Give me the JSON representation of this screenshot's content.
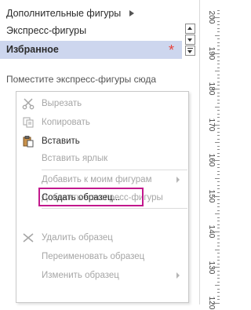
{
  "shapes_panel": {
    "more_shapes": "Дополнительные фигуры",
    "quick_shapes": "Экспресс-фигуры",
    "favorites": "Избранное",
    "favorites_marker": "*",
    "hint": "Поместите экспресс-фигуры сюда"
  },
  "context_menu": {
    "items": [
      {
        "label": "Вырезать",
        "icon": "scissors-icon",
        "enabled": false
      },
      {
        "label": "Копировать",
        "icon": "copy-icon",
        "enabled": false
      },
      {
        "label": "Вставить",
        "icon": "paste-icon",
        "enabled": true
      },
      {
        "label": "Вставить ярлык",
        "enabled": false
      },
      {
        "label": "Добавить к моим фигурам",
        "enabled": false,
        "submenu": true
      },
      {
        "label": "Добавить в экспресс-фигуры",
        "enabled": false
      },
      {
        "label": "Создать образец...",
        "enabled": true,
        "highlighted": true
      },
      {
        "label": "Удалить образец",
        "icon": "delete-x-icon",
        "enabled": false
      },
      {
        "label": "Переименовать образец",
        "enabled": false
      },
      {
        "label": "Изменить образец",
        "enabled": false,
        "submenu": true
      }
    ]
  },
  "ruler": {
    "labels": [
      "200",
      "190",
      "180",
      "170",
      "160",
      "150",
      "140",
      "130",
      "120"
    ]
  },
  "colors": {
    "selected_row": "#cdd6ee",
    "highlight_border": "#c2188d",
    "disabled_text": "#a6a6a6",
    "favorite_star": "#e8413a"
  }
}
